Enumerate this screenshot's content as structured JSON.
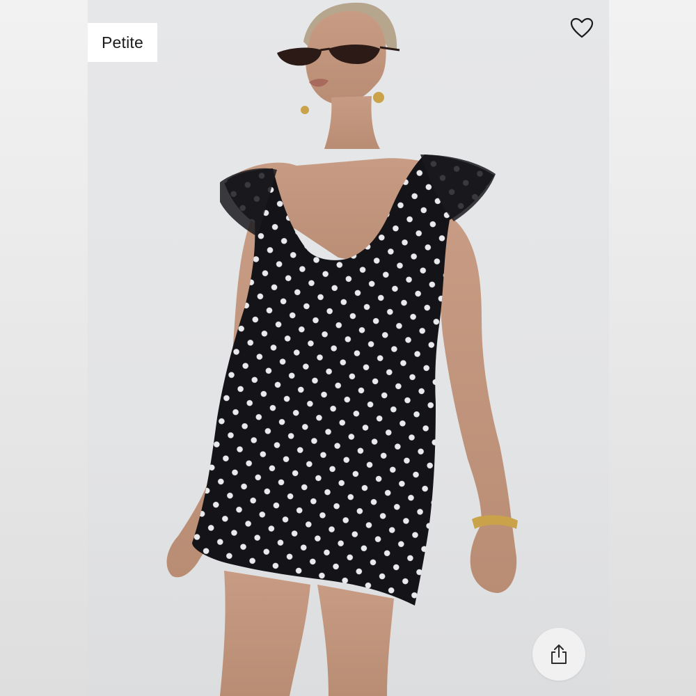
{
  "badge": {
    "label": "Petite"
  },
  "actions": {
    "favorite_icon": "heart-outline-icon",
    "share_icon": "share-icon"
  },
  "colors": {
    "dress": "#141418",
    "dots": "#e9eaee",
    "background": "#e6e7e9"
  }
}
